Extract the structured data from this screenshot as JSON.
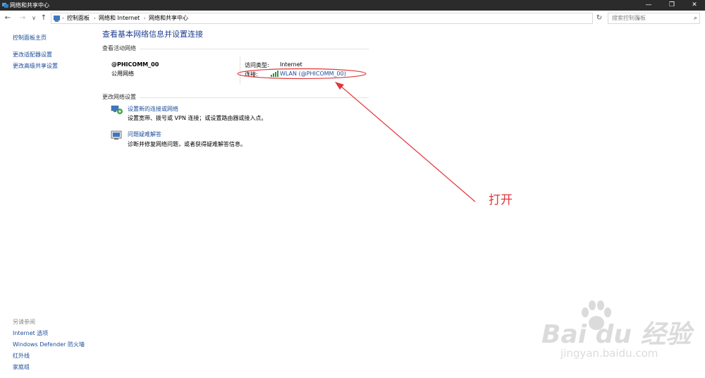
{
  "window": {
    "title": "网络和共享中心"
  },
  "controls": {
    "minimize": "—",
    "maximize": "❐",
    "close": "✕"
  },
  "nav": {
    "back": "←",
    "forward": "→",
    "recent": "∨",
    "up": "↑",
    "refresh": "↻",
    "separator": "›",
    "dropdown": "∨"
  },
  "breadcrumb": [
    "控制面板",
    "网络和 Internet",
    "网络和共享中心"
  ],
  "search": {
    "placeholder": "搜索控制面板"
  },
  "sidebar": {
    "links": [
      "控制面板主页",
      "更改适配器设置",
      "更改高级共享设置"
    ],
    "see_also_title": "另请参阅",
    "see_also": [
      "Internet 选项",
      "Windows Defender 防火墙",
      "红外线",
      "家庭组"
    ]
  },
  "main": {
    "title": "查看基本网络信息并设置连接",
    "active_networks_label": "查看活动网络",
    "network": {
      "name": "@PHICOMM_00",
      "category": "公用网络",
      "access_type_label": "访问类型:",
      "access_type_value": "Internet",
      "connection_label": "连接:",
      "connection_value": "WLAN (@PHICOMM_00)"
    },
    "change_settings_label": "更改网络设置",
    "tasks": [
      {
        "title": "设置新的连接或网络",
        "desc": "设置宽带、拨号或 VPN 连接；或设置路由器或接入点。",
        "icon": "network-setup-icon"
      },
      {
        "title": "问题疑难解答",
        "desc": "诊断并修复网络问题，或者获得疑难解答信息。",
        "icon": "troubleshoot-icon"
      }
    ]
  },
  "annotation": {
    "text": "打开",
    "color": "#e2363a"
  },
  "watermark": {
    "logo": "Bai du 经验",
    "url": "jingyan.baidu.com"
  },
  "colors": {
    "link": "#1a4c9a",
    "title": "#1e3e91",
    "titlebar": "#2b2b2b"
  }
}
